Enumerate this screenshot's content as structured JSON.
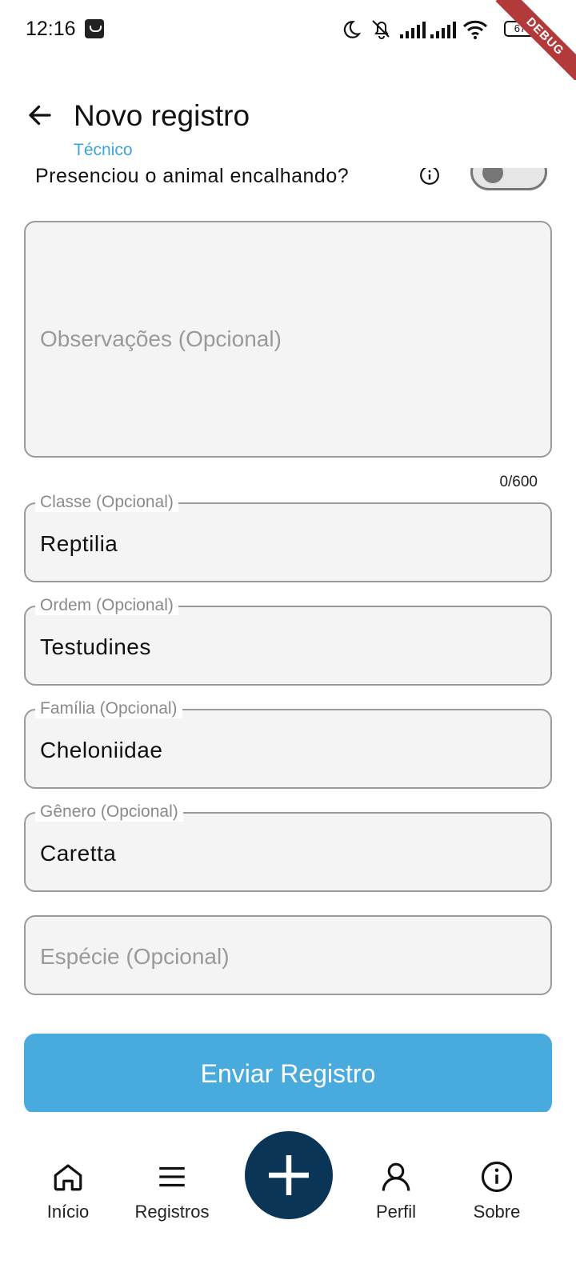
{
  "status_bar": {
    "time": "12:16",
    "battery": "67",
    "debug_label": "DEBUG"
  },
  "app_bar": {
    "title": "Novo registro",
    "subtitle": "Técnico"
  },
  "form": {
    "witnessed_label": "Presenciou o animal encalhando?",
    "witnessed_toggle_on": false,
    "observations_placeholder": "Observações (Opcional)",
    "observations_counter": "0/600",
    "fields": [
      {
        "label": "Classe (Opcional)",
        "value": "Reptilia"
      },
      {
        "label": "Ordem (Opcional)",
        "value": "Testudines"
      },
      {
        "label": "Família (Opcional)",
        "value": "Cheloniidae"
      },
      {
        "label": "Gênero (Opcional)",
        "value": "Caretta"
      }
    ],
    "species_placeholder": "Espécie (Opcional)",
    "submit_label": "Enviar Registro"
  },
  "bottom_nav": {
    "items": [
      {
        "label": "Início",
        "icon": "home-icon"
      },
      {
        "label": "Registros",
        "icon": "menu-icon"
      },
      {
        "label": "Perfil",
        "icon": "person-icon"
      },
      {
        "label": "Sobre",
        "icon": "info-icon"
      }
    ],
    "fab_icon": "plus-icon"
  },
  "colors": {
    "accent": "#48aadd",
    "subtitle": "#3ca4d6",
    "fab": "#0b3556",
    "debug": "#b23a3a"
  }
}
